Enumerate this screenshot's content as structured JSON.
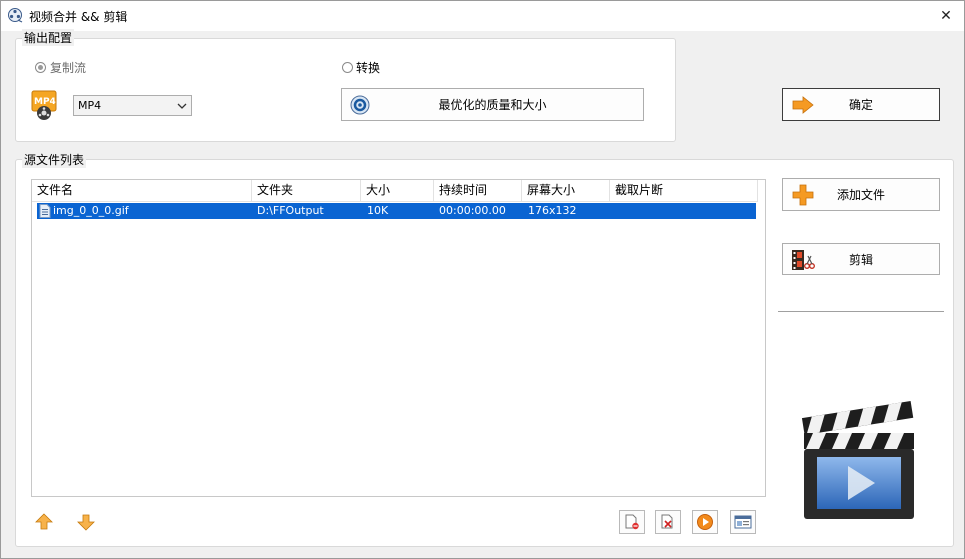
{
  "window": {
    "title": "视频合并 && 剪辑",
    "close_glyph": "✕"
  },
  "output_config": {
    "label": "输出配置",
    "copy_stream_label": "复制流",
    "convert_label": "转换",
    "format_selected": "MP4",
    "format_icon": "mp4-file-icon",
    "quality_button_label": "最优化的质量和大小"
  },
  "confirm_button_label": "确定",
  "source_files": {
    "label": "源文件列表",
    "columns": [
      "文件名",
      "文件夹",
      "大小",
      "持续时间",
      "屏幕大小",
      "截取片断"
    ],
    "rows": [
      {
        "name": "img_0_0_0.gif",
        "folder": "D:\\FFOutput",
        "size": "10K",
        "duration": "00:00:00.00",
        "screen": "176x132",
        "clip": ""
      }
    ]
  },
  "side_buttons": {
    "add_file_label": "添加文件",
    "edit_label": "剪辑"
  },
  "icons": {
    "move_up": "arrow-up-icon",
    "move_down": "arrow-down-icon",
    "remove": "remove-file-icon",
    "clear": "clear-list-icon",
    "play": "play-icon",
    "info": "info-icon",
    "clapper": "clapperboard-icon"
  },
  "colors": {
    "selection": "#0a64d2",
    "accent_orange": "#f59a23"
  }
}
